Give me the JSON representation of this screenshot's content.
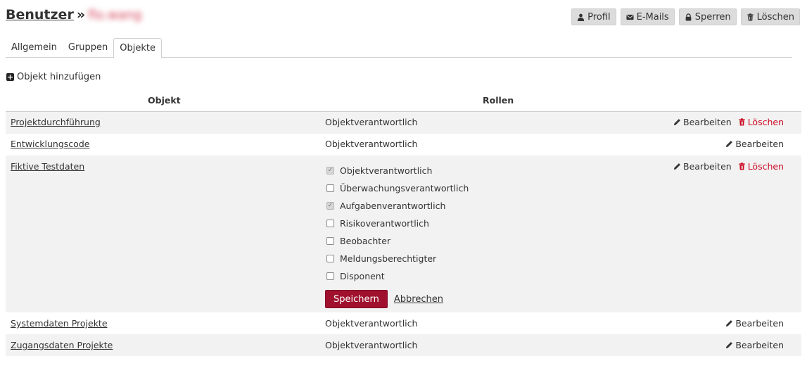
{
  "header": {
    "title": "Benutzer",
    "separator": "»",
    "username_blurred": "flo.wang",
    "actions": {
      "profile": "Profil",
      "emails": "E-Mails",
      "lock": "Sperren",
      "delete": "Löschen"
    }
  },
  "tabs": [
    {
      "label": "Allgemein"
    },
    {
      "label": "Gruppen"
    },
    {
      "label": "Objekte",
      "active": true
    }
  ],
  "add_object_label": "Objekt hinzufügen",
  "table": {
    "columns": {
      "object": "Objekt",
      "roles": "Rollen"
    },
    "rows": [
      {
        "object": "Projektdurchführung",
        "role": "Objektverantwortlich",
        "edit": "Bearbeiten",
        "delete": "Löschen"
      },
      {
        "object": "Entwicklungscode",
        "role": "Objektverantwortlich",
        "edit": "Bearbeiten"
      },
      {
        "object": "Fiktive Testdaten",
        "edit": "Bearbeiten",
        "delete": "Löschen"
      },
      {
        "object": "Systemdaten Projekte",
        "role": "Objektverantwortlich",
        "edit": "Bearbeiten"
      },
      {
        "object": "Zugangsdaten Projekte",
        "role": "Objektverantwortlich",
        "edit": "Bearbeiten"
      }
    ]
  },
  "role_editor": {
    "options": [
      {
        "label": "Objektverantwortlich",
        "checked": true
      },
      {
        "label": "Überwachungsverantwortlich",
        "checked": false
      },
      {
        "label": "Aufgabenverantwortlich",
        "checked": true
      },
      {
        "label": "Risikoverantwortlich",
        "checked": false
      },
      {
        "label": "Beobachter",
        "checked": false
      },
      {
        "label": "Meldungsberechtigter",
        "checked": false
      },
      {
        "label": "Disponent",
        "checked": false
      }
    ],
    "save_label": "Speichern",
    "cancel_label": "Abbrechen"
  },
  "colors": {
    "accent": "#a0112e",
    "danger": "#cc0a23",
    "row_alt": "#f2f2f2"
  }
}
